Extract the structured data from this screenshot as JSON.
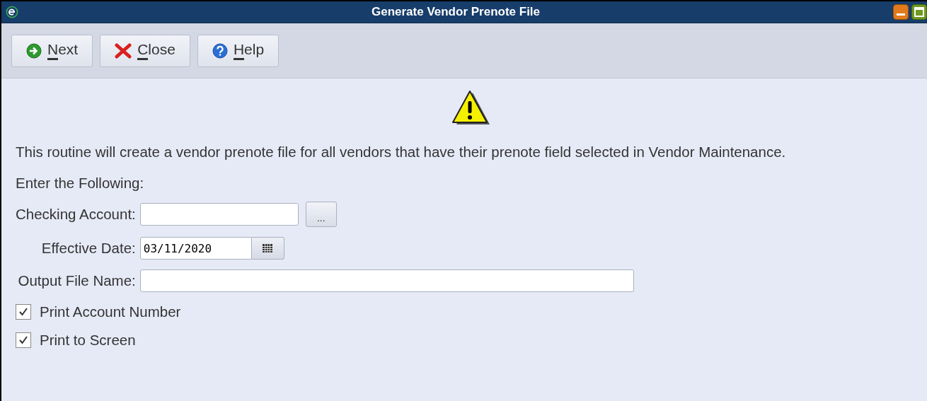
{
  "window": {
    "title": "Generate Vendor Prenote File"
  },
  "toolbar": [
    {
      "kind": "next",
      "label": "Next"
    },
    {
      "kind": "close",
      "label": "Close"
    },
    {
      "kind": "help",
      "label": "Help"
    }
  ],
  "message": "This routine will create a vendor prenote file for all vendors that have their prenote field selected in Vendor Maintenance.",
  "prompt": "Enter the Following:",
  "fields": [
    {
      "kind": "lookup",
      "label": "Checking Account:",
      "button": "..."
    },
    {
      "kind": "date",
      "label": "Effective Date:",
      "value": "03/11/2020"
    },
    {
      "kind": "text",
      "label": "Output File Name:"
    }
  ],
  "options": [
    {
      "label": "Print Account Number",
      "checked": true
    },
    {
      "label": "Print to Screen",
      "checked": true
    }
  ]
}
